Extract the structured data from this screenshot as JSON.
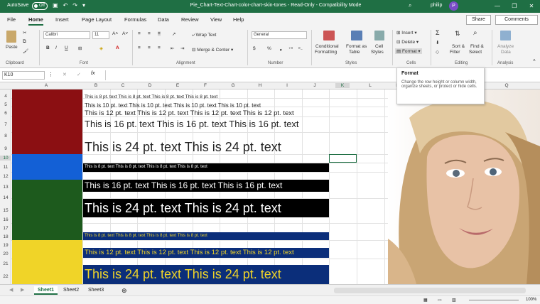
{
  "titlebar": {
    "autosave_label": "AutoSave",
    "autosave_state": "Off",
    "doc_title": "Pie_Chart-Text-Chart-color-chart-skin-tones  -  Read-Only  -  Compatibility Mode",
    "user_name": "philip",
    "user_initial": "P",
    "search_icon": "search-icon",
    "window_buttons": [
      "—",
      "❐",
      "✕"
    ]
  },
  "tabs": [
    "File",
    "Home",
    "Insert",
    "Page Layout",
    "Formulas",
    "Data",
    "Review",
    "View",
    "Help"
  ],
  "active_tab": "Home",
  "share_label": "Share",
  "comments_label": "Comments",
  "ribbon": {
    "clipboard": {
      "paste": "Paste",
      "label": "Clipboard"
    },
    "font": {
      "name": "Calibri",
      "size": "11",
      "label": "Font",
      "bold": "B",
      "italic": "I",
      "underline": "U"
    },
    "alignment": {
      "wrap": "Wrap Text",
      "merge": "Merge & Center",
      "label": "Alignment"
    },
    "number": {
      "format": "General",
      "label": "Number",
      "currency": "$",
      "percent": "%",
      "comma": "❟"
    },
    "styles": {
      "conditional": "Conditional",
      "conditional2": "Formatting",
      "format_as": "Format as",
      "table": "Table",
      "cell": "Cell",
      "styles": "Styles",
      "label": "Styles"
    },
    "cells": {
      "insert": "Insert",
      "delete": "Delete",
      "format": "Format",
      "label": "Cells"
    },
    "editing": {
      "sort": "Sort &",
      "filter": "Filter",
      "find": "Find &",
      "select": "Select",
      "label": "Editing"
    },
    "analysis": {
      "analyze": "Analyze",
      "data": "Data",
      "label": "Analysis"
    }
  },
  "formula_bar": {
    "name_box": "K10",
    "fx": "fx",
    "cancel": "✕",
    "enter": "✓"
  },
  "columns": [
    "A",
    "B",
    "C",
    "D",
    "E",
    "F",
    "G",
    "H",
    "I",
    "J",
    "K",
    "L",
    "M",
    "N",
    "O",
    "P",
    "Q"
  ],
  "rows": [
    "4",
    "5",
    "6",
    "7",
    "8",
    "9",
    "10",
    "11",
    "12",
    "13",
    "14",
    "15",
    "16",
    "17",
    "18",
    "19",
    "20",
    "21",
    "22"
  ],
  "cells": {
    "r4": "This is 8 pt. text  This is 8 pt. text  This is 8 pt. text  This is 8 pt. text",
    "r5": "This is 10 pt. text  This is 10 pt. text  This is 10 pt. text  This is 10 pt. text",
    "r6": "This is 12 pt. text  This is 12 pt. text  This is 12 pt. text  This is 12 pt. text",
    "r7": "This is 16 pt. text   This is 16 pt. text   This is 16 pt. text",
    "r9": "This is 24 pt. text   This is 24 pt. text",
    "r11": "This is 8 pt. text  This is 8 pt. text  This is 8 pt. text  This is 8 pt. text",
    "r13": "This is 16 pt. text   This is 16 pt. text   This is 16 pt. text",
    "r15": "This is 24 pt. text   This is 24 pt. text",
    "r18": "This is 8 pt. text  This is 8 pt. text  This is 8 pt. text  This is 8 pt. text",
    "r20": "This is 12 pt. text  This is 12 pt. text  This is 12 pt. text  This is 12 pt. text",
    "r22": "This is 24 pt. text   This is 24 pt. text"
  },
  "colors": {
    "red": "#8b0f12",
    "blue": "#1360d6",
    "green": "#1d5a1d",
    "yellow": "#f0d428",
    "black": "#000000",
    "navy": "#0b2e7a",
    "yellow_text": "#f0d428",
    "excel_green": "#1f6f44"
  },
  "tooltip": {
    "title": "Format",
    "body": "Change the row height or column width, organize sheets, or protect or hide cells."
  },
  "sheet_tabs": [
    "Sheet1",
    "Sheet2",
    "Sheet3"
  ],
  "active_sheet": "Sheet1",
  "statusbar": {
    "zoom": "100%"
  }
}
